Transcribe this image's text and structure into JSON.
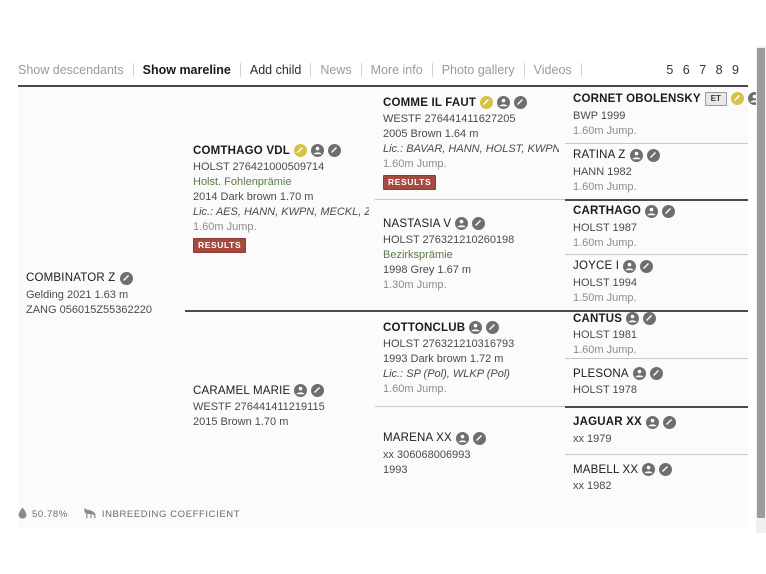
{
  "toolbar": {
    "links": [
      {
        "label": "Show descendants",
        "state": "muted"
      },
      {
        "label": "Show mareline",
        "state": "active"
      },
      {
        "label": "Add child",
        "state": "dark"
      },
      {
        "label": "News",
        "state": "muted"
      },
      {
        "label": "More info",
        "state": "muted"
      },
      {
        "label": "Photo gallery",
        "state": "muted"
      },
      {
        "label": "Videos",
        "state": "muted"
      }
    ],
    "pager": "5 6 7 8 9"
  },
  "pedigree": {
    "subject": {
      "name": "COMBINATOR Z",
      "bold": false,
      "icons": [
        "edit-icon"
      ],
      "lines": [
        "Gelding 2021 1.63 m",
        "ZANG 056015Z55362220"
      ]
    },
    "gen1": [
      {
        "name": "COMTHAGO VDL",
        "bold": true,
        "icons": [
          "gold-edit-icon",
          "pedigree-icon",
          "edit-icon"
        ],
        "lines": [
          {
            "text": "HOLST 276421000509714",
            "style": "plain"
          },
          {
            "text": "Holst. Fohlenprämie",
            "style": "green"
          },
          {
            "text": "2014 Dark brown 1.70 m",
            "style": "plain"
          },
          {
            "text": "Lic.: AES, HANN, KWPN, MECKL, ZANG",
            "style": "italic"
          },
          {
            "text": "1.60m Jump.",
            "style": "muted"
          }
        ],
        "badge": "RESULTS"
      },
      {
        "name": "CARAMEL MARIE",
        "bold": false,
        "icons": [
          "pedigree-icon",
          "edit-icon"
        ],
        "lines": [
          {
            "text": "WESTF 276441411219115",
            "style": "plain"
          },
          {
            "text": "2015 Brown 1.70 m",
            "style": "plain"
          }
        ],
        "badge": null
      }
    ],
    "gen2": [
      {
        "name": "COMME IL FAUT",
        "bold": true,
        "icons": [
          "gold-edit-icon",
          "pedigree-icon",
          "edit-icon"
        ],
        "lines": [
          {
            "text": "WESTF 276441411627205",
            "style": "plain"
          },
          {
            "text": "2005 Brown 1.64 m",
            "style": "plain"
          },
          {
            "text": "Lic.: BAVAR, HANN, HOLST, KWPN, MIP…",
            "style": "italic"
          },
          {
            "text": "1.60m Jump.",
            "style": "muted"
          }
        ],
        "badge": "RESULTS"
      },
      {
        "name": "NASTASIA V",
        "bold": false,
        "icons": [
          "pedigree-icon",
          "edit-icon"
        ],
        "lines": [
          {
            "text": "HOLST 276321210260198",
            "style": "plain"
          },
          {
            "text": "Bezirksprämie",
            "style": "green"
          },
          {
            "text": "1998 Grey 1.67 m",
            "style": "plain"
          },
          {
            "text": "1.30m Jump.",
            "style": "muted"
          }
        ],
        "badge": null
      },
      {
        "name": "COTTONCLUB",
        "bold": true,
        "icons": [
          "pedigree-icon",
          "edit-icon"
        ],
        "lines": [
          {
            "text": "HOLST 276321210316793",
            "style": "plain"
          },
          {
            "text": "1993 Dark brown 1.72 m",
            "style": "plain"
          },
          {
            "text": "Lic.: SP (Pol), WLKP (Pol)",
            "style": "italic"
          },
          {
            "text": "1.60m Jump.",
            "style": "muted"
          }
        ],
        "badge": null
      },
      {
        "name": "MARENA XX",
        "bold": false,
        "icons": [
          "pedigree-icon",
          "edit-icon"
        ],
        "lines": [
          {
            "text": "xx 306068006993",
            "style": "plain"
          },
          {
            "text": "1993",
            "style": "plain"
          }
        ],
        "badge": null
      }
    ],
    "gen3": [
      {
        "name": "CORNET OBOLENSKY",
        "bold": true,
        "icons": [
          "et-badge",
          "gold-edit-icon",
          "pedigree-icon",
          "edit-icon"
        ],
        "lines": [
          {
            "text": "BWP 1999",
            "style": "plain"
          },
          {
            "text": "1.60m Jump.",
            "style": "muted"
          }
        ]
      },
      {
        "name": "RATINA Z",
        "bold": false,
        "icons": [
          "pedigree-icon",
          "edit-icon"
        ],
        "lines": [
          {
            "text": "HANN 1982",
            "style": "plain"
          },
          {
            "text": "1.60m Jump.",
            "style": "muted"
          }
        ]
      },
      {
        "name": "CARTHAGO",
        "bold": true,
        "icons": [
          "pedigree-icon",
          "edit-icon"
        ],
        "lines": [
          {
            "text": "HOLST 1987",
            "style": "plain"
          },
          {
            "text": "1.60m Jump.",
            "style": "muted"
          }
        ]
      },
      {
        "name": "JOYCE I",
        "bold": false,
        "icons": [
          "pedigree-icon",
          "edit-icon"
        ],
        "lines": [
          {
            "text": "HOLST 1994",
            "style": "plain"
          },
          {
            "text": "1.50m Jump.",
            "style": "muted"
          }
        ]
      },
      {
        "name": "CANTUS",
        "bold": true,
        "icons": [
          "pedigree-icon",
          "edit-icon"
        ],
        "lines": [
          {
            "text": "HOLST 1981",
            "style": "plain"
          },
          {
            "text": "1.60m Jump.",
            "style": "muted"
          }
        ]
      },
      {
        "name": "PLESONA",
        "bold": false,
        "icons": [
          "pedigree-icon",
          "edit-icon"
        ],
        "lines": [
          {
            "text": "HOLST 1978",
            "style": "plain"
          }
        ]
      },
      {
        "name": "JAGUAR XX",
        "bold": true,
        "icons": [
          "pedigree-icon",
          "edit-icon"
        ],
        "lines": [
          {
            "text": "xx 1979",
            "style": "plain"
          }
        ]
      },
      {
        "name": "MABELL XX",
        "bold": false,
        "icons": [
          "pedigree-icon",
          "edit-icon"
        ],
        "lines": [
          {
            "text": "xx 1982",
            "style": "plain"
          }
        ]
      }
    ]
  },
  "footer": {
    "inbreeding_value": "50.78%",
    "inbreeding_label": "INBREEDING COEFFICIENT"
  },
  "colors": {
    "gold_icon": "#d4c24a",
    "gray_icon": "#6e6e6e",
    "results_badge": "#a44a3f",
    "green_text": "#5c7a44"
  }
}
